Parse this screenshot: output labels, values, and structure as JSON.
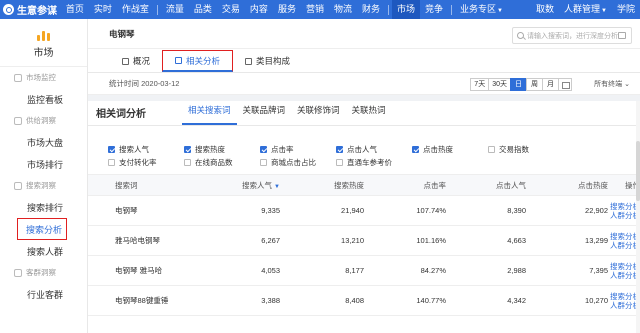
{
  "topbar": {
    "logo_text": "生意参谋",
    "nav": [
      {
        "label": "首页"
      },
      {
        "label": "实时"
      },
      {
        "label": "作战室"
      },
      {
        "label": "流量"
      },
      {
        "label": "品类"
      },
      {
        "label": "交易"
      },
      {
        "label": "内容"
      },
      {
        "label": "服务"
      },
      {
        "label": "营销"
      },
      {
        "label": "物流"
      },
      {
        "label": "财务"
      },
      {
        "label": "市场"
      },
      {
        "label": "竞争"
      },
      {
        "label": "业务专区"
      },
      {
        "label": "取数"
      },
      {
        "label": "人群管理"
      },
      {
        "label": "学院"
      }
    ],
    "active": "市场"
  },
  "sidebar": {
    "header_label": "市场",
    "groups": [
      {
        "label": "市场监控",
        "items": [
          "监控看板"
        ]
      },
      {
        "label": "供给洞察",
        "items": [
          "市场大盘",
          "市场排行"
        ]
      },
      {
        "label": "搜索洞察",
        "items": [
          "搜索排行",
          "搜索分析",
          "搜索人群"
        ]
      },
      {
        "label": "客群洞察",
        "items": [
          "行业客群"
        ]
      }
    ],
    "active_item": "搜索分析"
  },
  "main": {
    "title": "电钢琴",
    "search_placeholder": "请输入搜索词，进行深度分析",
    "tabs": [
      {
        "label": "概况"
      },
      {
        "label": "相关分析"
      },
      {
        "label": "类目构成"
      }
    ],
    "active_tab": "相关分析",
    "stat_time": "统计时间 2020-03-12",
    "periods": [
      "7天",
      "30天",
      "日",
      "周",
      "月"
    ],
    "active_period": "日",
    "terminal": "所有终端",
    "panel_title": "相关词分析",
    "subtabs": [
      "相关搜索词",
      "关联品牌词",
      "关联修饰词",
      "关联热词"
    ],
    "active_subtab": "相关搜索词",
    "checkboxes": [
      [
        {
          "label": "搜索人气",
          "checked": true
        },
        {
          "label": "搜索热度",
          "checked": true
        },
        {
          "label": "点击率",
          "checked": true
        },
        {
          "label": "点击人气",
          "checked": true
        },
        {
          "label": "点击热度",
          "checked": true
        },
        {
          "label": "交易指数",
          "checked": false
        }
      ],
      [
        {
          "label": "支付转化率",
          "checked": false
        },
        {
          "label": "在线商品数",
          "checked": false
        },
        {
          "label": "商城点击占比",
          "checked": false
        },
        {
          "label": "直通车参考价",
          "checked": false
        }
      ]
    ],
    "table": {
      "headers": [
        "搜索词",
        "搜索人气",
        "搜索热度",
        "点击率",
        "点击人气",
        "点击热度",
        "操作"
      ],
      "sort_icon": "sort-down-icon",
      "rows": [
        {
          "keyword": "电钢琴",
          "search_pop": "9,335",
          "search_heat": "21,940",
          "ctr": "107.74%",
          "click_pop": "8,390",
          "click_heat": "22,902"
        },
        {
          "keyword": "雅马哈电钢琴",
          "search_pop": "6,267",
          "search_heat": "13,210",
          "ctr": "101.16%",
          "click_pop": "4,663",
          "click_heat": "13,299"
        },
        {
          "keyword": "电钢琴 雅马哈",
          "search_pop": "4,053",
          "search_heat": "8,177",
          "ctr": "84.27%",
          "click_pop": "2,988",
          "click_heat": "7,395"
        },
        {
          "keyword": "电钢琴88键重锤",
          "search_pop": "3,388",
          "search_heat": "8,408",
          "ctr": "140.77%",
          "click_pop": "4,342",
          "click_heat": "10,270"
        }
      ],
      "op_labels": [
        "搜索分析",
        "人群分析"
      ]
    }
  }
}
